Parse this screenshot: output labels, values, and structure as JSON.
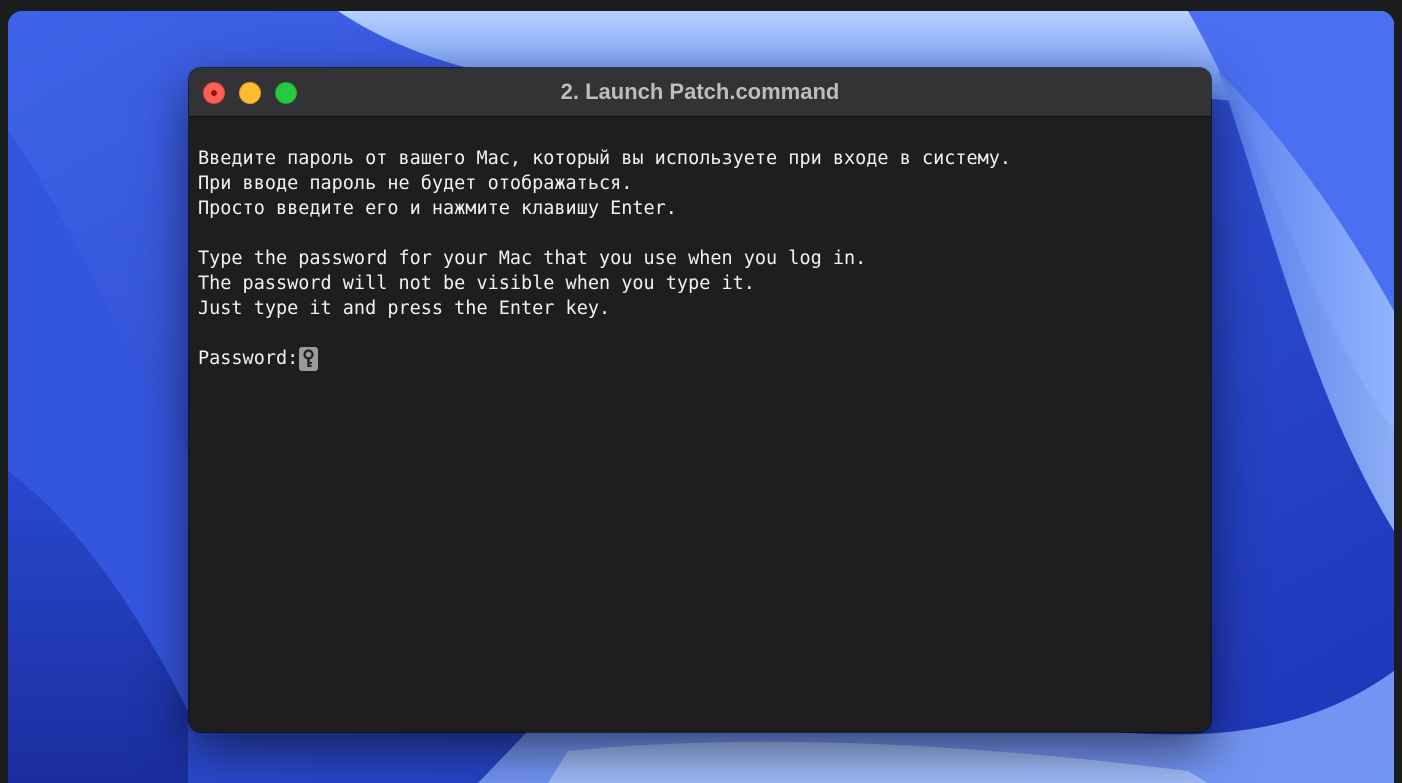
{
  "window": {
    "title": "2. Launch Patch.command"
  },
  "terminal": {
    "lines": [
      "Введите пароль от вашего Mac, который вы используете при входе в систему.",
      "При вводе пароль не будет отображаться.",
      "Просто введите его и нажмите клавишу Enter.",
      "",
      "Type the password for your Mac that you use when you log in.",
      "The password will not be visible when you type it.",
      "Just type it and press the Enter key.",
      ""
    ],
    "prompt": "Password:",
    "cursor_icon": "key-icon"
  },
  "colors": {
    "desktop_blue": "#2f4fd8",
    "terminal_bg": "#1e1e1e",
    "titlebar_bg": "#333335",
    "text": "#f2f2f2",
    "close": "#fe5f57",
    "minimize": "#febc2e",
    "zoom": "#28c840"
  }
}
